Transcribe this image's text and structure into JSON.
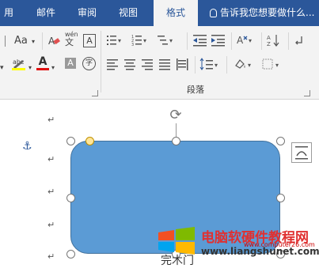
{
  "tabs": {
    "partial_first": "用",
    "mail": "邮件",
    "review": "审阅",
    "view": "视图",
    "format": "格式"
  },
  "tellme": {
    "placeholder": "告诉我您想要做什么..."
  },
  "ribbon": {
    "font_size_label": "Aa",
    "wen_top": "wén",
    "wen_char": "文",
    "border_char": "A",
    "font_color_char": "A",
    "shade_char": "A",
    "circled_char": "字",
    "abc": "abc",
    "paragraph_group": "段落"
  },
  "document": {
    "para_mark": "↵",
    "anchor": "⚓"
  },
  "watermark": {
    "title": "电脑软硬件教程网",
    "url": "www.liangshunet.com",
    "overlay_url": "www.computer26.com",
    "partial_text": "完木门"
  },
  "colors": {
    "title_bar": "#2b579a",
    "shape_fill": "#5b9bd5",
    "shape_border": "#41719c",
    "font_color_red": "#e01010"
  }
}
